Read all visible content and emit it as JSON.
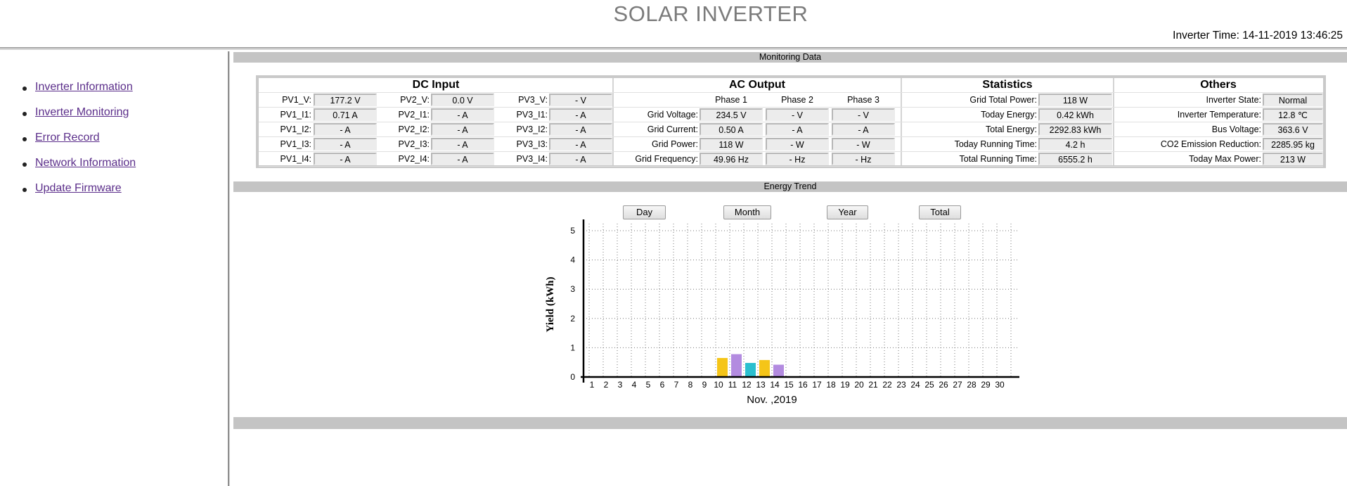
{
  "header": {
    "title": "SOLAR INVERTER",
    "inverter_time_label": "Inverter Time:",
    "inverter_time_value": "14-11-2019 13:46:25"
  },
  "sidebar": {
    "items": [
      {
        "label": "Inverter Information"
      },
      {
        "label": "Inverter Monitoring"
      },
      {
        "label": "Error Record"
      },
      {
        "label": "Network Information"
      },
      {
        "label": "Update Firmware"
      }
    ]
  },
  "monitoring": {
    "section_title": "Monitoring Data",
    "groups": {
      "dc": "DC Input",
      "ac": "AC Output",
      "stats": "Statistics",
      "others": "Others"
    },
    "dc_rows": [
      [
        [
          "PV1_V:",
          "177.2 V"
        ],
        [
          "PV2_V:",
          "0.0 V"
        ],
        [
          "PV3_V:",
          "- V"
        ]
      ],
      [
        [
          "PV1_I1:",
          "0.71 A"
        ],
        [
          "PV2_I1:",
          "- A"
        ],
        [
          "PV3_I1:",
          "- A"
        ]
      ],
      [
        [
          "PV1_I2:",
          "- A"
        ],
        [
          "PV2_I2:",
          "- A"
        ],
        [
          "PV3_I2:",
          "- A"
        ]
      ],
      [
        [
          "PV1_I3:",
          "- A"
        ],
        [
          "PV2_I3:",
          "- A"
        ],
        [
          "PV3_I3:",
          "- A"
        ]
      ],
      [
        [
          "PV1_I4:",
          "- A"
        ],
        [
          "PV2_I4:",
          "- A"
        ],
        [
          "PV3_I4:",
          "- A"
        ]
      ]
    ],
    "ac_phases": [
      "Phase 1",
      "Phase 2",
      "Phase 3"
    ],
    "ac_rows": [
      [
        "Grid Voltage:",
        "234.5 V",
        "- V",
        "- V"
      ],
      [
        "Grid Current:",
        "0.50 A",
        "- A",
        "- A"
      ],
      [
        "Grid Power:",
        "118 W",
        "- W",
        "- W"
      ],
      [
        "Grid Frequency:",
        "49.96 Hz",
        "- Hz",
        "- Hz"
      ]
    ],
    "stats_rows": [
      [
        "Grid Total Power:",
        "118 W"
      ],
      [
        "Today Energy:",
        "0.42 kWh"
      ],
      [
        "Total Energy:",
        "2292.83 kWh"
      ],
      [
        "Today Running Time:",
        "4.2 h"
      ],
      [
        "Total Running Time:",
        "6555.2 h"
      ]
    ],
    "others_rows": [
      [
        "Inverter State:",
        "Normal"
      ],
      [
        "Inverter Temperature:",
        "12.8 ℃"
      ],
      [
        "Bus Voltage:",
        "363.6 V"
      ],
      [
        "CO2 Emission Reduction:",
        "2285.95 kg"
      ],
      [
        "Today Max Power:",
        "213 W"
      ]
    ]
  },
  "energy": {
    "section_title": "Energy Trend",
    "buttons": [
      "Day",
      "Month",
      "Year",
      "Total"
    ]
  },
  "colors": {
    "bar_yellow": "#f5c518",
    "bar_purple": "#b38be0",
    "bar_teal": "#2bbfcf"
  },
  "chart_data": {
    "type": "bar",
    "title": "",
    "ylabel": "Yield (kWh)",
    "xlabel": "Nov. ,2019",
    "ylim": [
      0,
      5
    ],
    "yticks": [
      "0",
      "1",
      "2",
      "3",
      "4",
      "5"
    ],
    "grid": true,
    "categories": [
      "1",
      "2",
      "3",
      "4",
      "5",
      "6",
      "7",
      "8",
      "9",
      "10",
      "11",
      "12",
      "13",
      "14",
      "15",
      "16",
      "17",
      "18",
      "19",
      "20",
      "21",
      "22",
      "23",
      "24",
      "25",
      "26",
      "27",
      "28",
      "29",
      "30"
    ],
    "values": [
      0,
      0,
      0,
      0,
      0,
      0,
      0,
      0,
      0,
      0.65,
      0.78,
      0.48,
      0.58,
      0.42,
      0,
      0,
      0,
      0,
      0,
      0,
      0,
      0,
      0,
      0,
      0,
      0,
      0,
      0,
      0,
      0
    ],
    "bar_colors": {
      "10": "#f5c518",
      "11": "#b38be0",
      "12": "#2bbfcf",
      "13": "#f5c518",
      "14": "#b38be0"
    }
  }
}
